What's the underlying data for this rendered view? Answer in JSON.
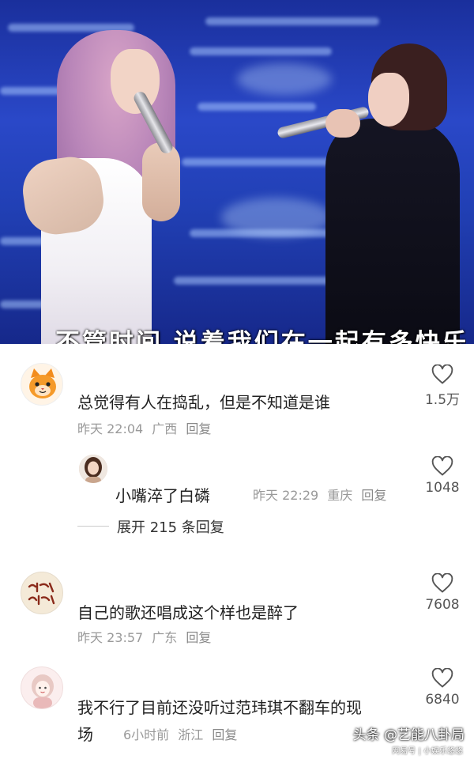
{
  "video": {
    "subtitle": "不管时间 说着我们在一起有多快乐"
  },
  "comments": [
    {
      "text": "总觉得有人在捣乱，但是不知道是谁",
      "time": "昨天 22:04",
      "location": "广西",
      "reply_label": "回复",
      "likes": "1.5万",
      "avatar_icon": "cat-icon"
    },
    {
      "text": "小嘴淬了白磷",
      "time": "昨天 22:29",
      "location": "重庆",
      "reply_label": "回复",
      "likes": "1048",
      "avatar_icon": "person-photo"
    },
    {
      "text": "自己的歌还唱成这个样也是醉了",
      "time": "昨天 23:57",
      "location": "广东",
      "reply_label": "回复",
      "likes": "7608",
      "avatar_icon": "calligraphy-avatar"
    },
    {
      "text": "我不行了目前还没听过范玮琪不翻车的现",
      "text_line2": "场",
      "time": "6小时前",
      "location": "浙江",
      "reply_label": "回复",
      "likes": "6840",
      "avatar_icon": "girl-illustration-avatar"
    }
  ],
  "expand_replies": "展开 215 条回复",
  "watermark": {
    "main": "头条 @艺能八卦局",
    "sub": "网易号 | 小娱乐悠悠"
  },
  "colors": {
    "video_bg": "#2140b5",
    "text": "#222222",
    "meta": "#999999"
  }
}
